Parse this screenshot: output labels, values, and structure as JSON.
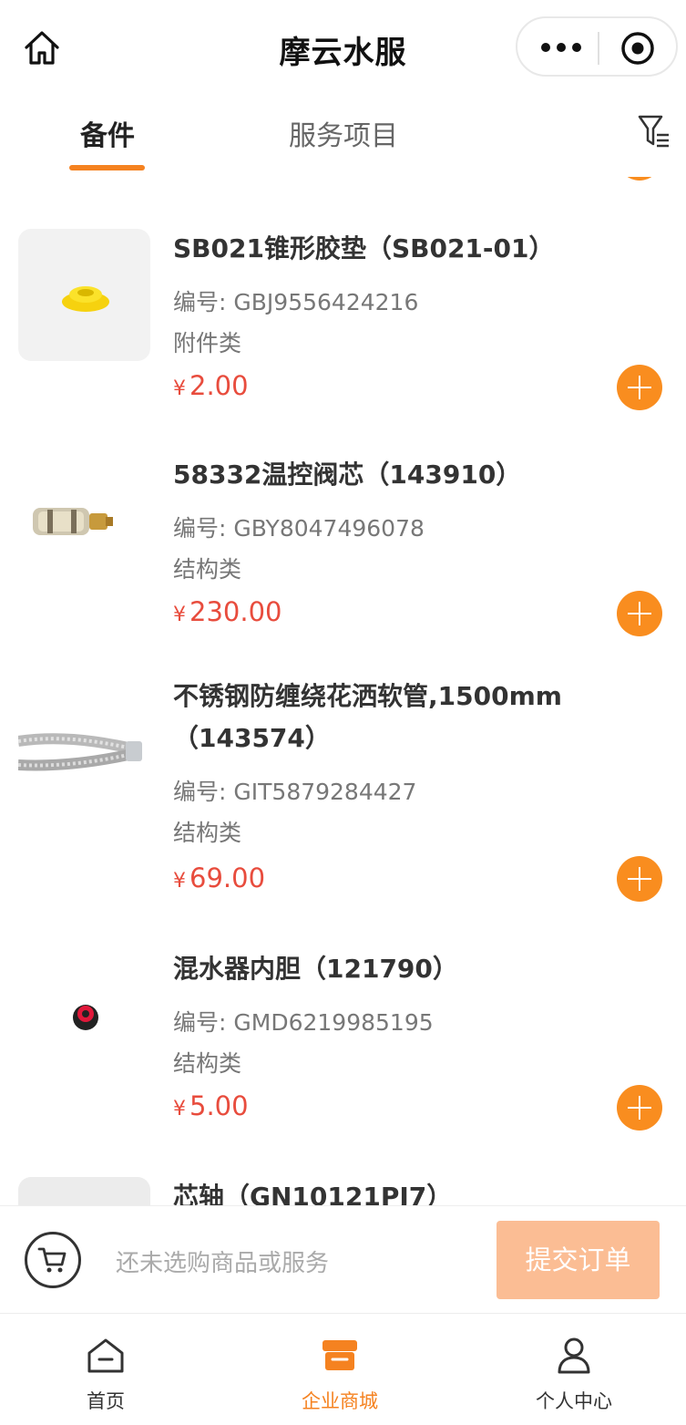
{
  "header": {
    "title": "摩云水服",
    "icons": {
      "home": "home-icon",
      "more": "more-dots-icon",
      "close": "target-close-icon"
    }
  },
  "tabs": [
    {
      "label": "备件",
      "active": true
    },
    {
      "label": "服务项目",
      "active": false
    }
  ],
  "filter_icon": "filter-icon",
  "products": [
    {
      "name": "SB021锥形胶垫（SB021-01）",
      "code_label": "编号:",
      "code": "GBJ9556424216",
      "category": "附件类",
      "currency": "¥",
      "price": "2.00"
    },
    {
      "name": "58332温控阀芯（143910）",
      "code_label": "编号:",
      "code": "GBY8047496078",
      "category": "结构类",
      "currency": "¥",
      "price": "230.00"
    },
    {
      "name": "不锈钢防缠绕花洒软管,1500mm（143574）",
      "code_label": "编号:",
      "code": "GIT5879284427",
      "category": "结构类",
      "currency": "¥",
      "price": "69.00"
    },
    {
      "name": "混水器内胆（121790）",
      "code_label": "编号:",
      "code": "GMD6219985195",
      "category": "结构类",
      "currency": "¥",
      "price": "5.00"
    },
    {
      "name": "芯轴（GN10121PJ7）"
    }
  ],
  "cart": {
    "hint": "还未选购商品或服务",
    "submit_label": "提交订单"
  },
  "bottom_nav": [
    {
      "label": "首页",
      "icon": "home-tab-icon",
      "active": false
    },
    {
      "label": "企业商城",
      "icon": "store-icon",
      "active": true
    },
    {
      "label": "个人中心",
      "icon": "person-icon",
      "active": false
    }
  ],
  "colors": {
    "accent": "#f58220",
    "price": "#e84c3d",
    "submit_disabled": "#fbbd94"
  }
}
